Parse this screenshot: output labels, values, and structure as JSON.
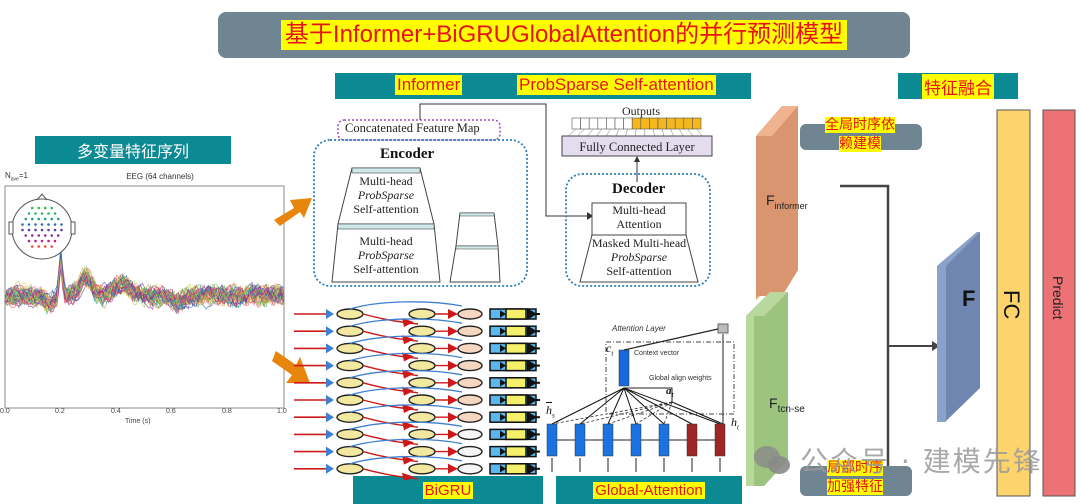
{
  "title": "基于Informer+BiGRUGlobalAttention的并行预测模型",
  "sections": {
    "informer_label": "Informer",
    "probsparse_label": "ProbSparse Self-attention",
    "fusion_label": "特征融合",
    "multivariate_label": "多变量特征序列",
    "bigru_label": "BiGRU",
    "global_attention_label": "Global-Attention"
  },
  "eeg_plot": {
    "title": "EEG (64 channels)",
    "nave_label": "N",
    "nave_sub": "ave",
    "nave_value": "=1",
    "xlabel": "Time (s)",
    "xticks": [
      "0.0",
      "0.2",
      "0.4",
      "0.6",
      "0.8",
      "1.0"
    ]
  },
  "informer": {
    "concat_label": "Concatenated Feature Map",
    "encoder_title": "Encoder",
    "encoder_block1": [
      "Multi-head",
      "ProbSparse",
      "Self-attention"
    ],
    "encoder_block2": [
      "Multi-head",
      "ProbSparse",
      "Self-attention"
    ],
    "outputs_label": "Outputs",
    "fc_label": "Fully Connected Layer",
    "decoder_title": "Decoder",
    "decoder_block1": [
      "Multi-head",
      "Attention"
    ],
    "decoder_block2": [
      "Masked Multi-head",
      "ProbSparse",
      "Self-attention"
    ],
    "output_cells_empty": 7,
    "output_cells_filled": 8
  },
  "bigru": {
    "rows": 10
  },
  "attention": {
    "layer_label": "Attention Layer",
    "context_label": "Context vector",
    "align_label": "Global align weights",
    "ct": "c",
    "ct_sub": "t",
    "at": "a",
    "at_sub": "t",
    "hs": "h",
    "hs_sub": "s",
    "ht": "h",
    "ht_sub": "t"
  },
  "fusion": {
    "f_informer_main": "F",
    "f_informer_sub": "informer",
    "f_tcn_main": "F",
    "f_tcn_sub": "tcn-se",
    "note_global": [
      "全局时序依",
      "赖建模"
    ],
    "note_local": [
      "局部时序",
      "加强特征"
    ],
    "f_label": "F",
    "fc_label": "FC",
    "predict_label": "Predict"
  },
  "colors": {
    "teal": "#0c8a93",
    "highlight_yellow": "#ffff00",
    "highlight_red": "#e8121c",
    "informer_block": "#d9956f",
    "tcn_block": "#9cc47f",
    "f_block": "#6f86b0",
    "fc_bar": "#fdd46b",
    "predict_bar": "#ec7275",
    "arrow_orange": "#e8850c"
  },
  "watermark": "公众号 · 建模先锋"
}
